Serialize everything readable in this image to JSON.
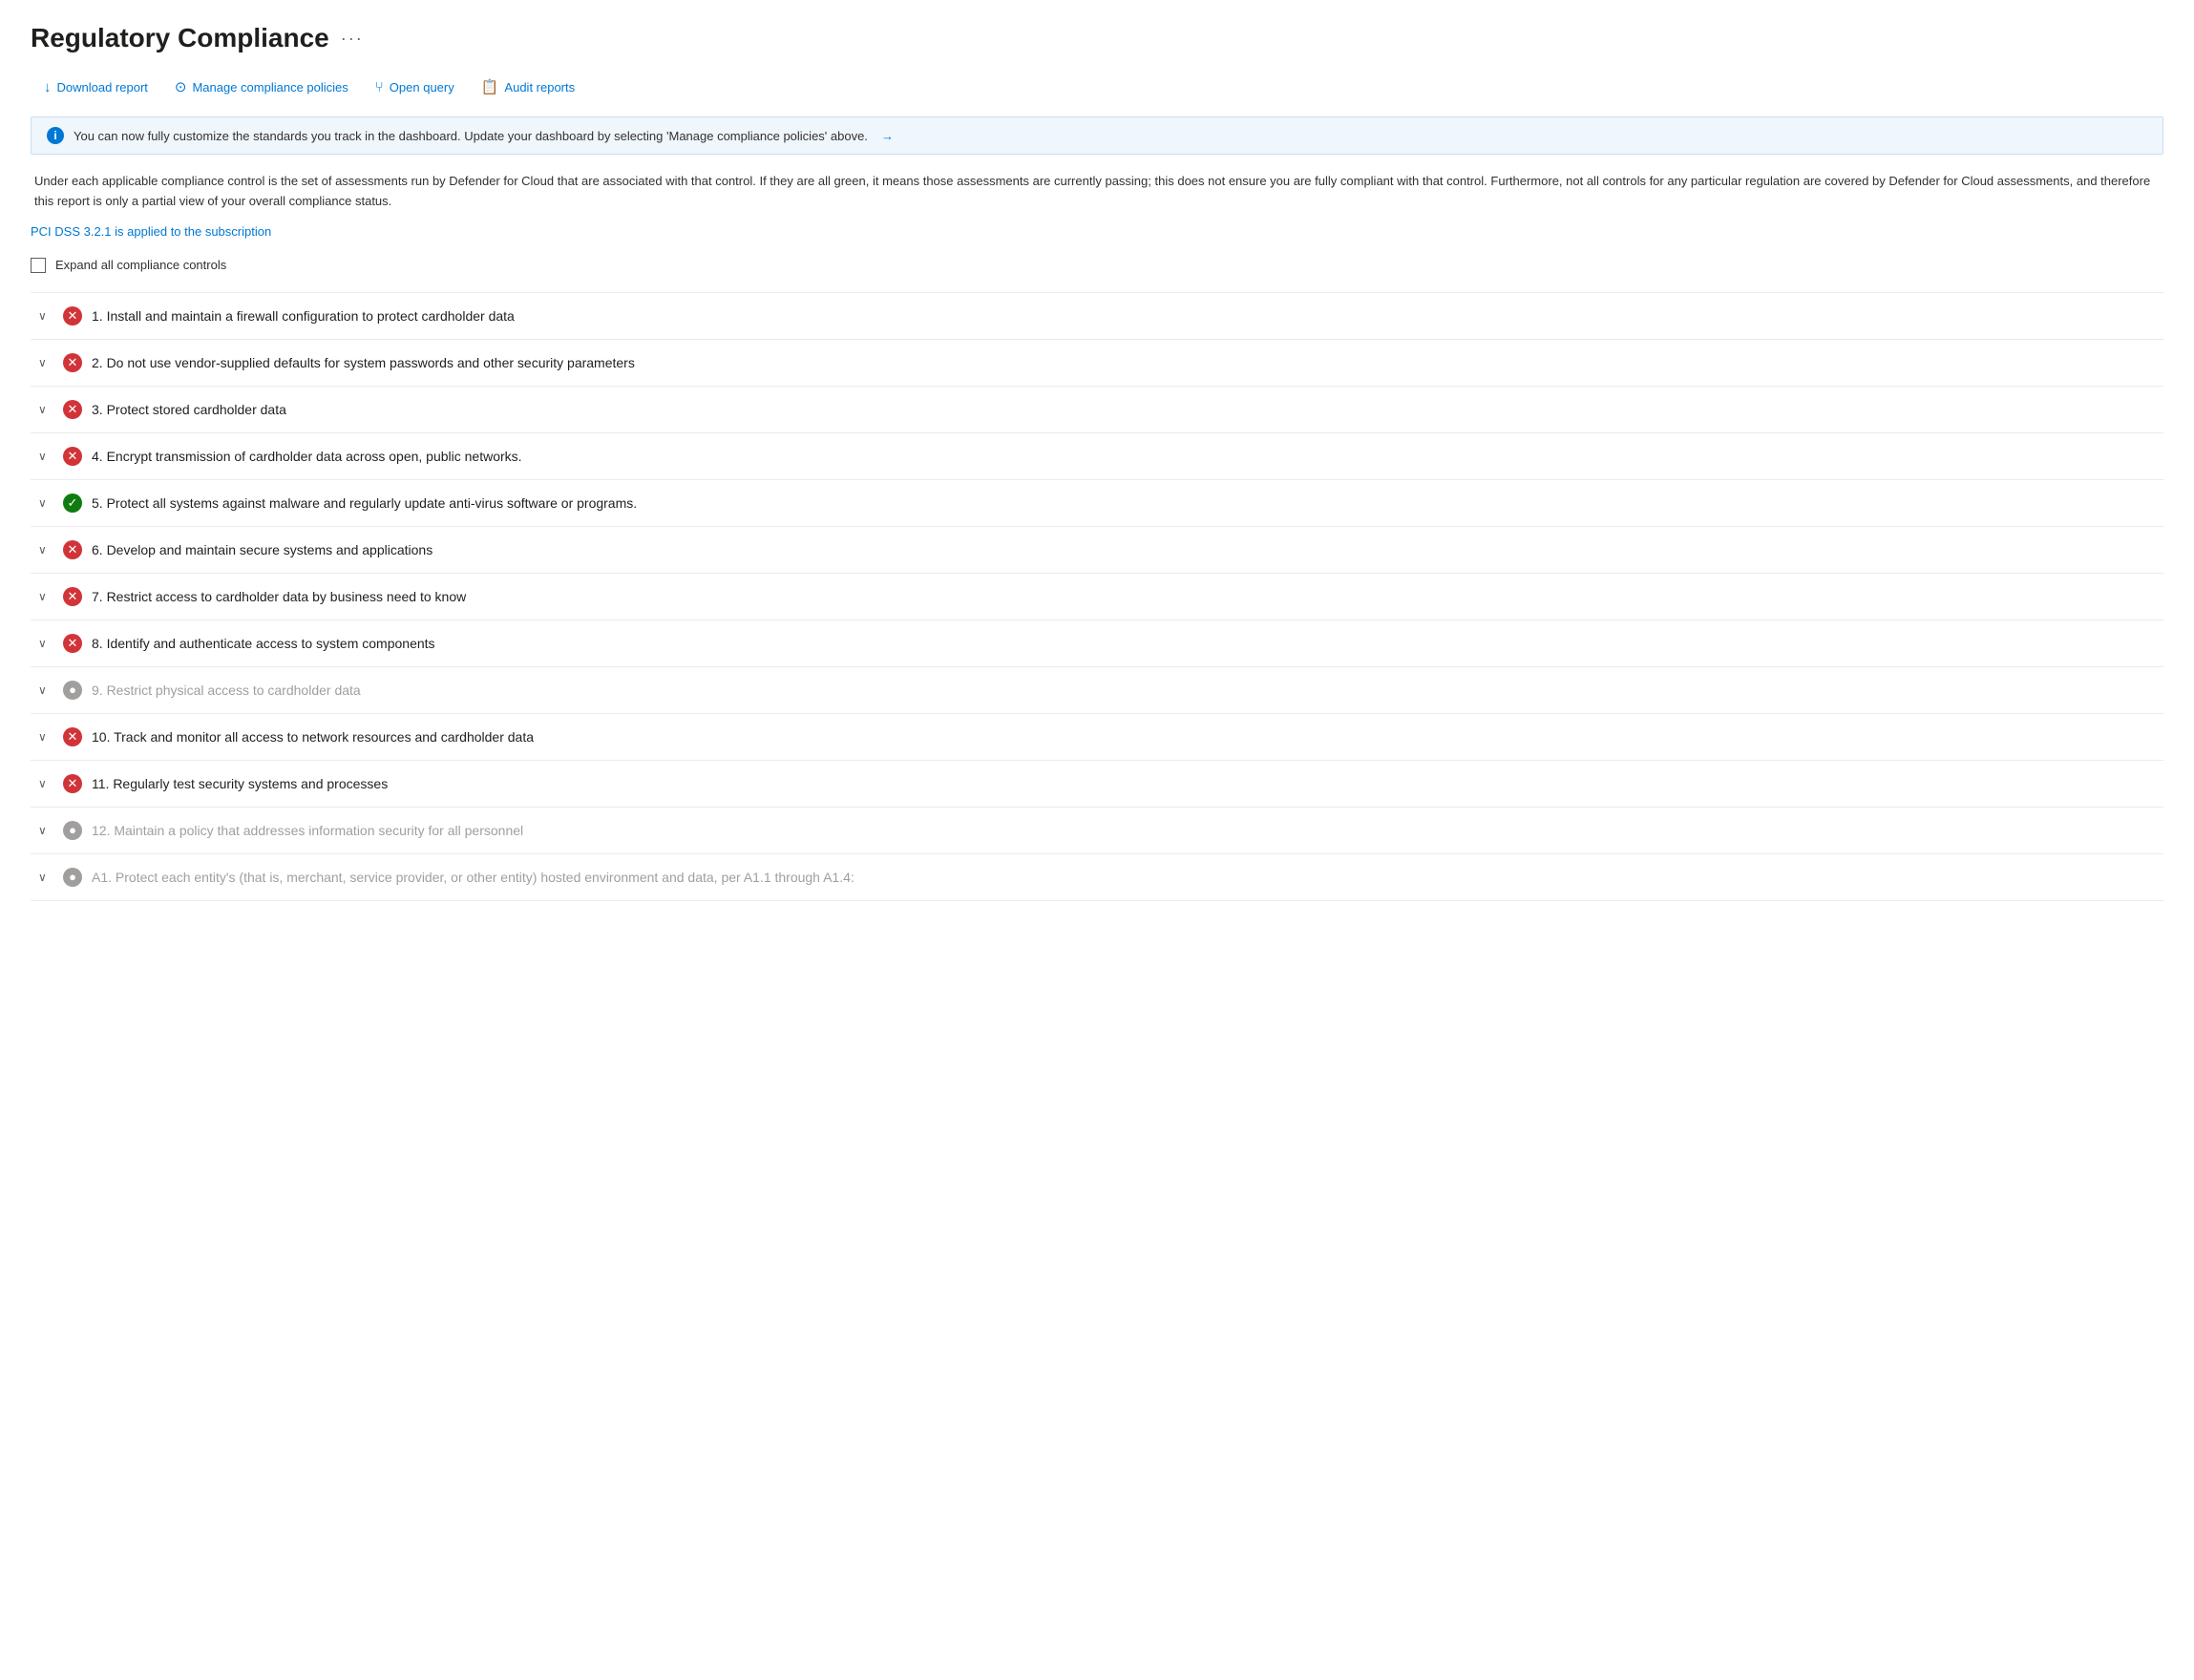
{
  "page": {
    "title": "Regulatory Compliance",
    "ellipsis": "···"
  },
  "toolbar": {
    "buttons": [
      {
        "id": "download-report",
        "label": "Download report",
        "icon": "↓"
      },
      {
        "id": "manage-compliance",
        "label": "Manage compliance policies",
        "icon": "⊙"
      },
      {
        "id": "open-query",
        "label": "Open query",
        "icon": "⑂"
      },
      {
        "id": "audit-reports",
        "label": "Audit reports",
        "icon": "📋"
      }
    ]
  },
  "info_banner": {
    "text": "You can now fully customize the standards you track in the dashboard. Update your dashboard by selecting 'Manage compliance policies' above.",
    "arrow": "→"
  },
  "description": "Under each applicable compliance control is the set of assessments run by Defender for Cloud that are associated with that control. If they are all green, it means those assessments are currently passing; this does not ensure you are fully compliant with that control. Furthermore, not all controls for any particular regulation are covered by Defender for Cloud assessments, and therefore this report is only a partial view of your overall compliance status.",
  "subscription_link": "PCI DSS 3.2.1 is applied to the subscription",
  "expand_all_label": "Expand all compliance controls",
  "compliance_items": [
    {
      "id": "item-1",
      "status": "fail",
      "label": "1. Install and maintain a firewall configuration to protect cardholder data",
      "grayed": false
    },
    {
      "id": "item-2",
      "status": "fail",
      "label": "2. Do not use vendor-supplied defaults for system passwords and other security parameters",
      "grayed": false
    },
    {
      "id": "item-3",
      "status": "fail",
      "label": "3. Protect stored cardholder data",
      "grayed": false
    },
    {
      "id": "item-4",
      "status": "fail",
      "label": "4. Encrypt transmission of cardholder data across open, public networks.",
      "grayed": false
    },
    {
      "id": "item-5",
      "status": "pass",
      "label": "5. Protect all systems against malware and regularly update anti-virus software or programs.",
      "grayed": false
    },
    {
      "id": "item-6",
      "status": "fail",
      "label": "6. Develop and maintain secure systems and applications",
      "grayed": false
    },
    {
      "id": "item-7",
      "status": "fail",
      "label": "7. Restrict access to cardholder data by business need to know",
      "grayed": false
    },
    {
      "id": "item-8",
      "status": "fail",
      "label": "8. Identify and authenticate access to system components",
      "grayed": false
    },
    {
      "id": "item-9",
      "status": "na",
      "label": "9. Restrict physical access to cardholder data",
      "grayed": true
    },
    {
      "id": "item-10",
      "status": "fail",
      "label": "10. Track and monitor all access to network resources and cardholder data",
      "grayed": false
    },
    {
      "id": "item-11",
      "status": "fail",
      "label": "11. Regularly test security systems and processes",
      "grayed": false
    },
    {
      "id": "item-12",
      "status": "na",
      "label": "12. Maintain a policy that addresses information security for all personnel",
      "grayed": true
    },
    {
      "id": "item-a1",
      "status": "na",
      "label": "A1. Protect each entity's (that is, merchant, service provider, or other entity) hosted environment and data, per A1.1 through A1.4:",
      "grayed": true
    }
  ]
}
